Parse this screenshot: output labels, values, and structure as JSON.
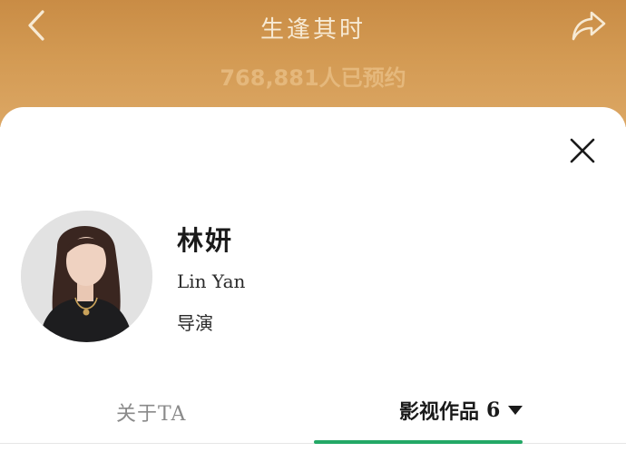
{
  "header": {
    "title": "生逢其时",
    "reservations": "768,881人已预约"
  },
  "person": {
    "name_zh": "林妍",
    "name_en": "Lin Yan",
    "role": "导演"
  },
  "tabs": {
    "about": "关于TA",
    "works_label": "影视作品",
    "works_count": "6"
  },
  "icons": {
    "back": "chevron-left-icon",
    "share": "share-icon",
    "close": "close-icon",
    "dropdown": "caret-down-icon"
  },
  "colors": {
    "header_gold": "#d39a53",
    "active_tab_indicator": "#23a866"
  }
}
